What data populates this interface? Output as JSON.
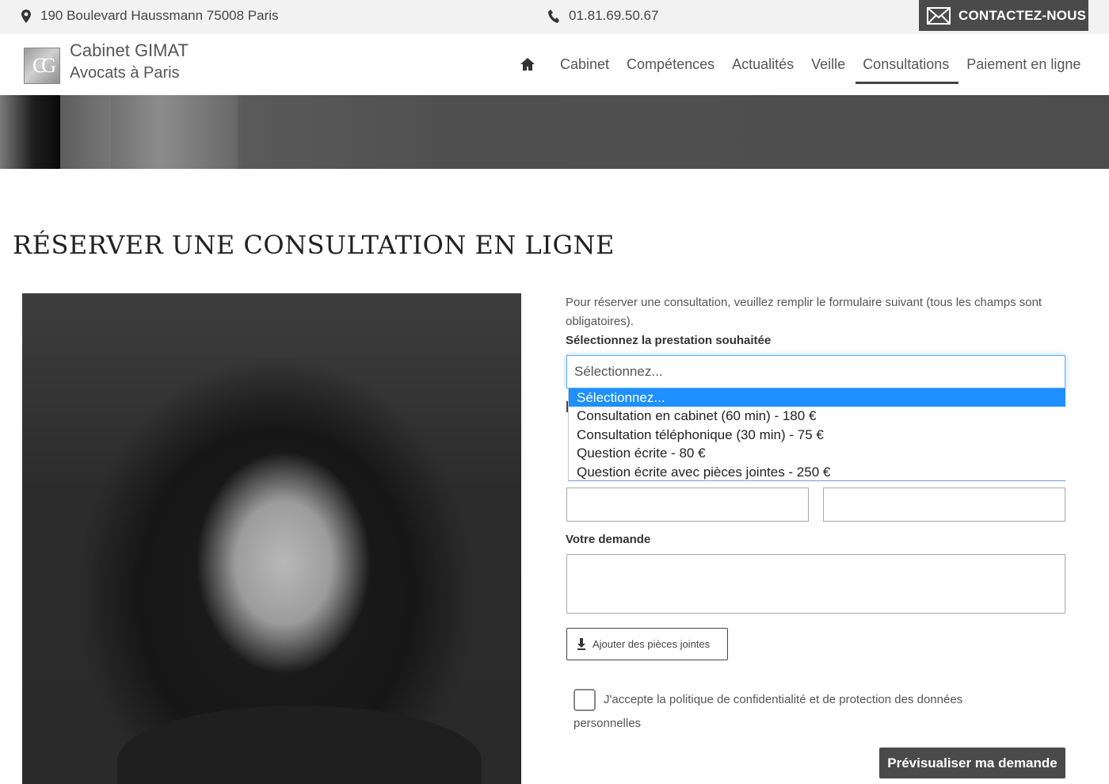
{
  "topbar": {
    "address": "190 Boulevard Haussmann 75008 Paris",
    "phone": "01.81.69.50.67",
    "contact_label": "CONTACTEZ-NOUS"
  },
  "brand": {
    "logo_text": "CG",
    "line1": "Cabinet GIMAT",
    "line2": "Avocats à Paris"
  },
  "nav": {
    "items": [
      "Cabinet",
      "Compétences",
      "Actualités",
      "Veille",
      "Consultations",
      "Paiement en ligne"
    ],
    "active": "Consultations"
  },
  "page": {
    "title": "RÉSERVER UNE CONSULTATION EN LIGNE"
  },
  "form": {
    "intro": "Pour réserver une consultation, veuillez remplir le formulaire suivant (tous les champs sont obligatoires).",
    "service_label": "Sélectionnez la prestation souhaitée",
    "service_value": "Sélectionnez...",
    "service_options": [
      "Sélectionnez...",
      "Consultation en cabinet (60 min) - 180 €",
      "Consultation téléphonique (30 min) - 75 €",
      "Question écrite - 80 €",
      "Question écrite avec pièces jointes - 250 €"
    ],
    "request_label": "Votre demande",
    "attach_label": "Ajouter des pièces jointes",
    "consent_label": "J'accepte la politique de confidentialité et de protection des données personnelles",
    "submit_label": "Prévisualiser ma demande"
  },
  "colors": {
    "accent_dark": "#4a4a4a",
    "select_focus": "#66afe9",
    "option_highlight": "#1e90ff"
  },
  "icons": {
    "address": "map-pin-icon",
    "phone": "phone-icon",
    "contact": "envelope-icon",
    "home": "home-icon",
    "attach": "download-icon"
  }
}
